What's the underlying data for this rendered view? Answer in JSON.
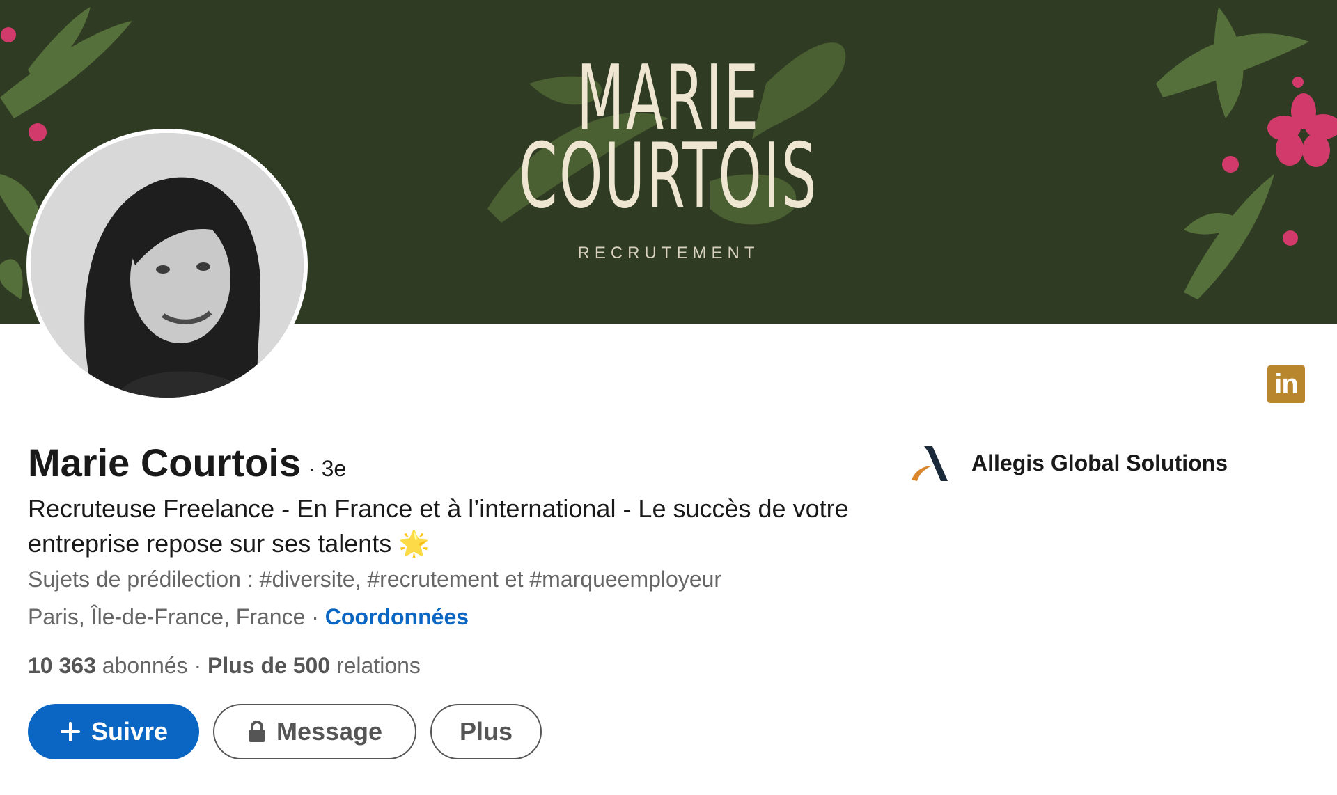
{
  "banner": {
    "line1": "MARIE",
    "line2": "COURTOIS",
    "subtitle": "RECRUTEMENT"
  },
  "profile": {
    "name": "Marie Courtois",
    "degree": "· 3e",
    "headline": "Recruteuse Freelance - En France et à l’international - Le succès de votre entreprise repose sur ses talents 🌟",
    "topics": "Sujets de prédilection : #diversite, #recrutement et #marqueemployeur",
    "location": "Paris, Île-de-France, France",
    "location_separator": " · ",
    "contact_link": "Coordonnées",
    "followers_count": "10 363",
    "followers_label": " abonnés",
    "stats_separator": "  · ",
    "connections_count": "Plus de 500",
    "connections_label": " relations"
  },
  "company": {
    "name": "Allegis Global Solutions"
  },
  "actions": {
    "follow": "Suivre",
    "message": "Message",
    "more": "Plus"
  },
  "badge": {
    "label": "in"
  },
  "colors": {
    "banner_bg": "#2f3b22",
    "banner_text": "#efe6d2",
    "primary_blue": "#0a66c2",
    "linkedin_badge": "#b8862c",
    "flower_pink": "#d13a6b",
    "leaf_green": "#56703c"
  },
  "icons": {
    "follow": "plus-icon",
    "message": "lock-icon",
    "badge": "linkedin-icon"
  }
}
